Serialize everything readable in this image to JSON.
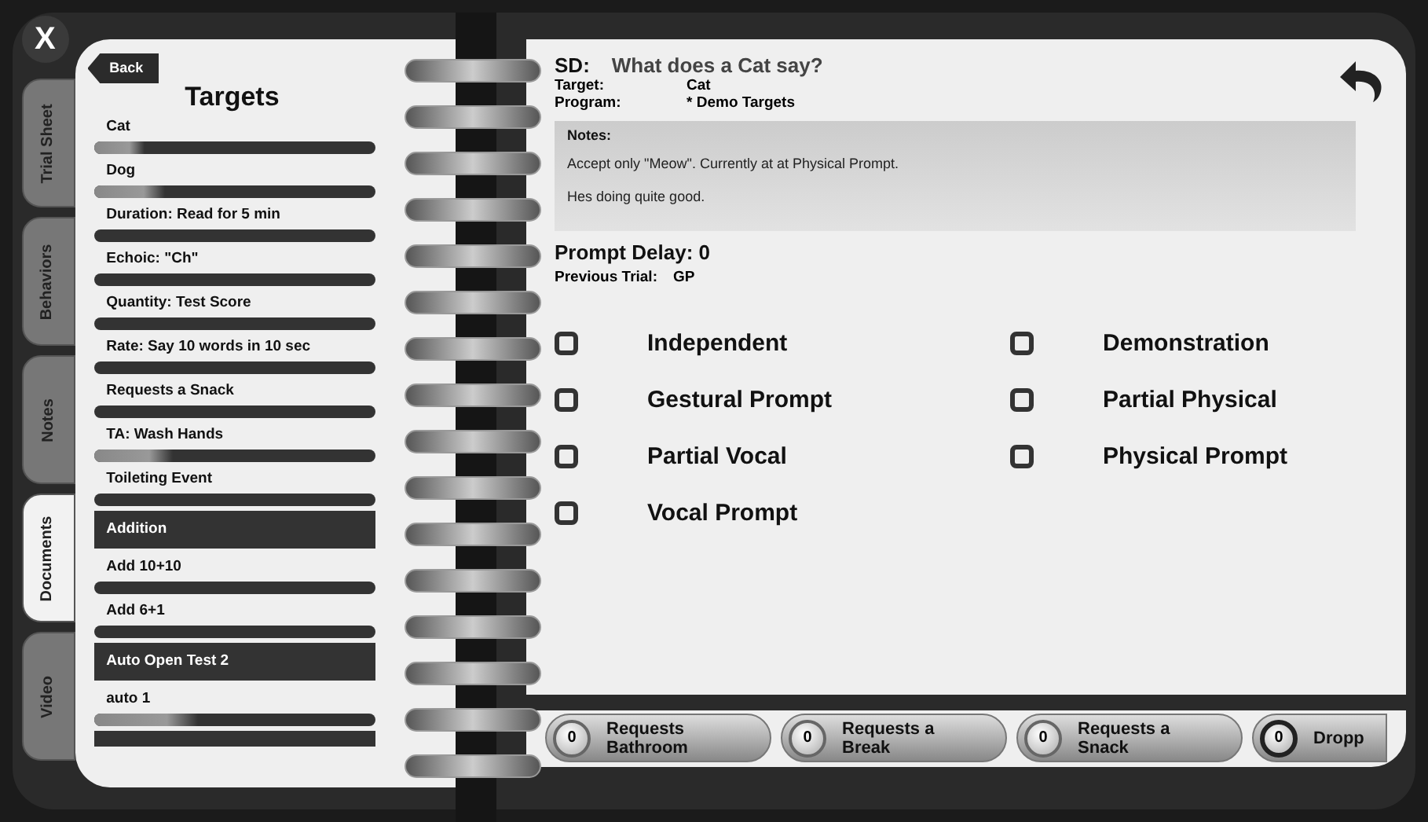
{
  "close_button": {
    "label": "X"
  },
  "side_tabs": [
    {
      "label": "Trial Sheet",
      "selected": false
    },
    {
      "label": "Behaviors",
      "selected": false
    },
    {
      "label": "Notes",
      "selected": false
    },
    {
      "label": "Documents",
      "selected": true
    },
    {
      "label": "Video",
      "selected": false
    }
  ],
  "targets_panel": {
    "back_button": "Back",
    "title": "Targets",
    "items": [
      {
        "kind": "target",
        "label": "Cat",
        "level": 0.18
      },
      {
        "kind": "target",
        "label": "Dog",
        "level": 0.25
      },
      {
        "kind": "target",
        "label": "Duration: Read for 5 min",
        "level": 0
      },
      {
        "kind": "target",
        "label": "Echoic: \"Ch\"",
        "level": 0
      },
      {
        "kind": "target",
        "label": "Quantity: Test Score",
        "level": 0
      },
      {
        "kind": "target",
        "label": "Rate: Say 10 words in 10 sec",
        "level": 0
      },
      {
        "kind": "target",
        "label": "Requests a Snack",
        "level": 0
      },
      {
        "kind": "target",
        "label": "TA: Wash Hands",
        "level": 0.28
      },
      {
        "kind": "target",
        "label": "Toileting Event",
        "level": 0
      },
      {
        "kind": "group",
        "label": "Addition"
      },
      {
        "kind": "target",
        "label": "Add 10+10",
        "level": 0
      },
      {
        "kind": "target",
        "label": "Add 6+1",
        "level": 0
      },
      {
        "kind": "group",
        "label": "Auto Open Test 2"
      },
      {
        "kind": "target",
        "label": "auto 1",
        "level": 0.37
      },
      {
        "kind": "group_cut"
      }
    ]
  },
  "trial": {
    "sd_label": "SD:",
    "sd_question": "What does a Cat say?",
    "target_label": "Target:",
    "target_value": "Cat",
    "program_label": "Program:",
    "program_value": "* Demo Targets",
    "notes": {
      "title": "Notes:",
      "lines": [
        "Accept only \"Meow\". Currently at at Physical Prompt.",
        "Hes doing quite good."
      ]
    },
    "prompt_delay": "Prompt Delay: 0",
    "previous_trial_label": "Previous Trial:",
    "previous_trial_value": "GP",
    "prompts": [
      {
        "label": "Independent",
        "checked": false
      },
      {
        "label": "Demonstration",
        "checked": false
      },
      {
        "label": "Gestural Prompt",
        "checked": false
      },
      {
        "label": "Partial Physical",
        "checked": false
      },
      {
        "label": "Partial Vocal",
        "checked": false
      },
      {
        "label": "Physical Prompt",
        "checked": false
      },
      {
        "label": "Vocal Prompt",
        "checked": false
      }
    ]
  },
  "behavior_buttons": [
    {
      "count": "0",
      "label": "Requests Bathroom",
      "selected": false
    },
    {
      "count": "0",
      "label": "Requests a Break",
      "selected": false
    },
    {
      "count": "0",
      "label": "Requests a Snack",
      "selected": false
    },
    {
      "count": "0",
      "label": "Dropp",
      "selected": true
    }
  ]
}
